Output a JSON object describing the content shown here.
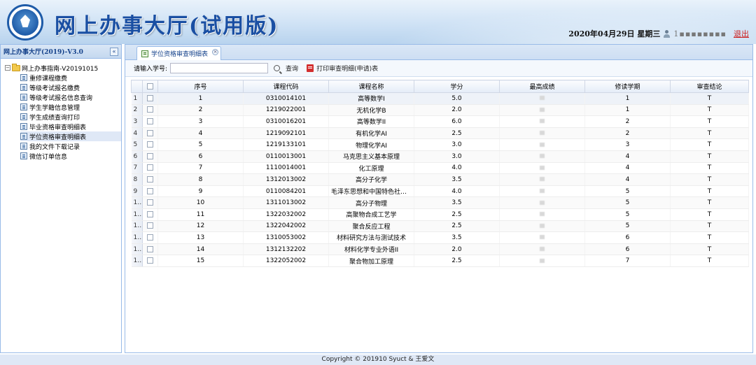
{
  "header": {
    "title": "网上办事大厅(试用版)",
    "date": "2020年04月29日 星期三",
    "username": "1▪▪▪▪▪▪▪▪",
    "logout": "退出"
  },
  "sidebar": {
    "title": "网上办事大厅(2019)-V3.0",
    "collapse_glyph": "«",
    "root_label": "网上办事指南-V20191015",
    "items": [
      {
        "label": "重修课程缴费"
      },
      {
        "label": "等级考试报名缴费"
      },
      {
        "label": "等级考试报名信息查询"
      },
      {
        "label": "学生学籍信息管理"
      },
      {
        "label": "学生成绩查询打印"
      },
      {
        "label": "毕业资格审查明细表"
      },
      {
        "label": "学位资格审查明细表"
      },
      {
        "label": "我的文件下载记录"
      },
      {
        "label": "微信订单信息"
      }
    ],
    "selected_index": 6
  },
  "tab": {
    "label": "学位资格审查明细表",
    "close_glyph": "×"
  },
  "toolbar": {
    "input_label": "请输入学号:",
    "search_value": "",
    "query_label": "查询",
    "print_label": "打印审查明细(申请)表"
  },
  "table": {
    "columns": [
      "序号",
      "课程代码",
      "课程名称",
      "学分",
      "最高成绩",
      "修读学期",
      "审查结论"
    ],
    "rows": [
      [
        "1",
        "0310014101",
        "高等数学I",
        "5.0",
        "",
        "1",
        "T"
      ],
      [
        "2",
        "1219022001",
        "无机化学B",
        "2.0",
        "",
        "1",
        "T"
      ],
      [
        "3",
        "0310016201",
        "高等数学II",
        "6.0",
        "",
        "2",
        "T"
      ],
      [
        "4",
        "1219092101",
        "有机化学AI",
        "2.5",
        "",
        "2",
        "T"
      ],
      [
        "5",
        "1219133101",
        "物理化学AI",
        "3.0",
        "",
        "3",
        "T"
      ],
      [
        "6",
        "0110013001",
        "马克思主义基本原理",
        "3.0",
        "",
        "4",
        "T"
      ],
      [
        "7",
        "1110014001",
        "化工原理",
        "4.0",
        "",
        "4",
        "T"
      ],
      [
        "8",
        "1312013002",
        "高分子化学",
        "3.5",
        "",
        "4",
        "T"
      ],
      [
        "9",
        "0110084201",
        "毛泽东思想和中国特色社会主义理论体系概论",
        "4.0",
        "",
        "5",
        "T"
      ],
      [
        "10",
        "1311013002",
        "高分子物理",
        "3.5",
        "",
        "5",
        "T"
      ],
      [
        "11",
        "1322032002",
        "高聚物合成工艺学",
        "2.5",
        "",
        "5",
        "T"
      ],
      [
        "12",
        "1322042002",
        "聚合反应工程",
        "2.5",
        "",
        "5",
        "T"
      ],
      [
        "13",
        "1310053002",
        "材料研究方法与测试技术",
        "3.5",
        "",
        "6",
        "T"
      ],
      [
        "14",
        "1312132202",
        "材料化学专业外语II",
        "2.0",
        "",
        "6",
        "T"
      ],
      [
        "15",
        "1322052002",
        "聚合物加工原理",
        "2.5",
        "",
        "7",
        "T"
      ]
    ]
  },
  "footer": {
    "copyright": "Copyright © 201910 Syuct & 王爱文"
  }
}
